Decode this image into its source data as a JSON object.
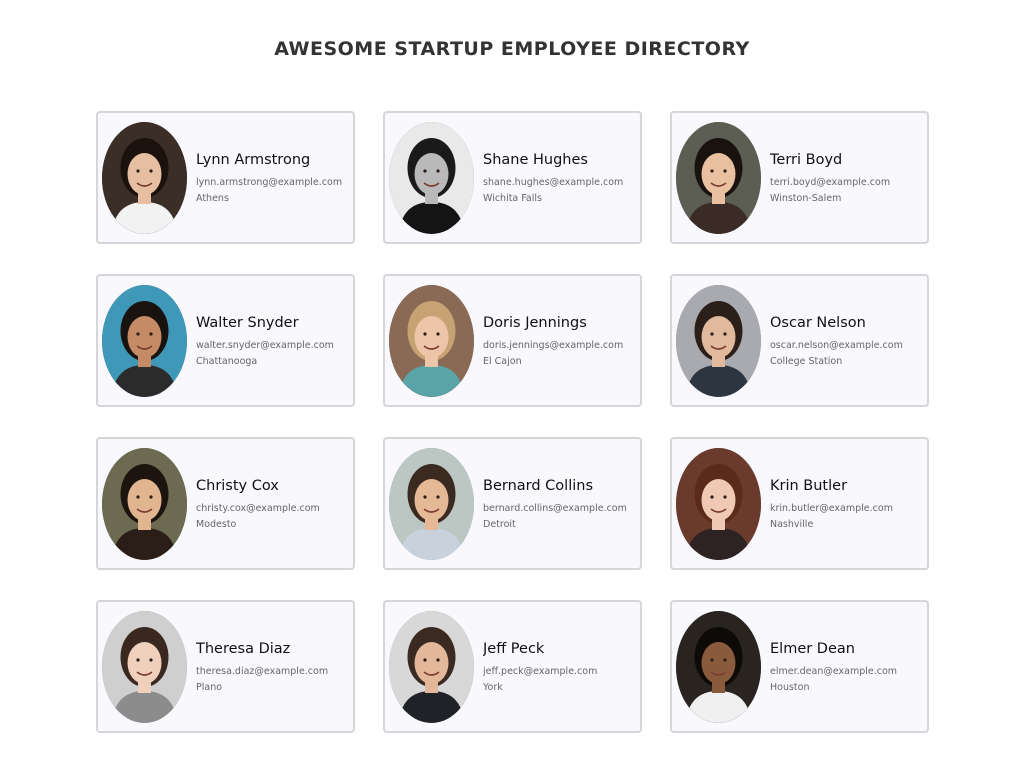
{
  "header": {
    "title": "AWESOME STARTUP EMPLOYEE DIRECTORY"
  },
  "employees": [
    {
      "name": "Lynn Armstrong",
      "email": "lynn.armstrong@example.com",
      "city": "Athens",
      "bg": "#3a2e26",
      "hair": "#1c120d",
      "skin": "#e6bfa2",
      "shirt": "#f2f2f2"
    },
    {
      "name": "Shane Hughes",
      "email": "shane.hughes@example.com",
      "city": "Wichita Falls",
      "bg": "#e9e9e9",
      "hair": "#1a1a1a",
      "skin": "#b9b9b9",
      "shirt": "#141414"
    },
    {
      "name": "Terri Boyd",
      "email": "terri.boyd@example.com",
      "city": "Winston-Salem",
      "bg": "#5c5e54",
      "hair": "#1a120e",
      "skin": "#e9c1a0",
      "shirt": "#3b2b27"
    },
    {
      "name": "Walter Snyder",
      "email": "walter.snyder@example.com",
      "city": "Chattanooga",
      "bg": "#3f98b8",
      "hair": "#191310",
      "skin": "#c58a66",
      "shirt": "#2b2b2b"
    },
    {
      "name": "Doris Jennings",
      "email": "doris.jennings@example.com",
      "city": "El Cajon",
      "bg": "#8a6a55",
      "hair": "#c7a374",
      "skin": "#edc6aa",
      "shirt": "#5aa3a6"
    },
    {
      "name": "Oscar Nelson",
      "email": "oscar.nelson@example.com",
      "city": "College Station",
      "bg": "#a9aab0",
      "hair": "#2b1f19",
      "skin": "#e1b99c",
      "shirt": "#2d3540"
    },
    {
      "name": "Christy Cox",
      "email": "christy.cox@example.com",
      "city": "Modesto",
      "bg": "#6d6a52",
      "hair": "#1d140f",
      "skin": "#e2b591",
      "shirt": "#2b1e18"
    },
    {
      "name": "Bernard Collins",
      "email": "bernard.collins@example.com",
      "city": "Detroit",
      "bg": "#bcc7c4",
      "hair": "#3a2a20",
      "skin": "#e5b896",
      "shirt": "#c9d1dc"
    },
    {
      "name": "Krin Butler",
      "email": "krin.butler@example.com",
      "city": "Nashville",
      "bg": "#6a3b2c",
      "hair": "#5a2a1b",
      "skin": "#f0c9b4",
      "shirt": "#2d2323"
    },
    {
      "name": "Theresa Diaz",
      "email": "theresa.diaz@example.com",
      "city": "Plano",
      "bg": "#cfcfcf",
      "hair": "#3a2720",
      "skin": "#efd0bd",
      "shirt": "#8c8c8c"
    },
    {
      "name": "Jeff Peck",
      "email": "jeff.peck@example.com",
      "city": "York",
      "bg": "#d8d8d8",
      "hair": "#3b2a22",
      "skin": "#e3b799",
      "shirt": "#1f2226"
    },
    {
      "name": "Elmer Dean",
      "email": "elmer.dean@example.com",
      "city": "Houston",
      "bg": "#2a2420",
      "hair": "#0e0a08",
      "skin": "#8a5a3c",
      "shirt": "#f0f0f0"
    }
  ]
}
